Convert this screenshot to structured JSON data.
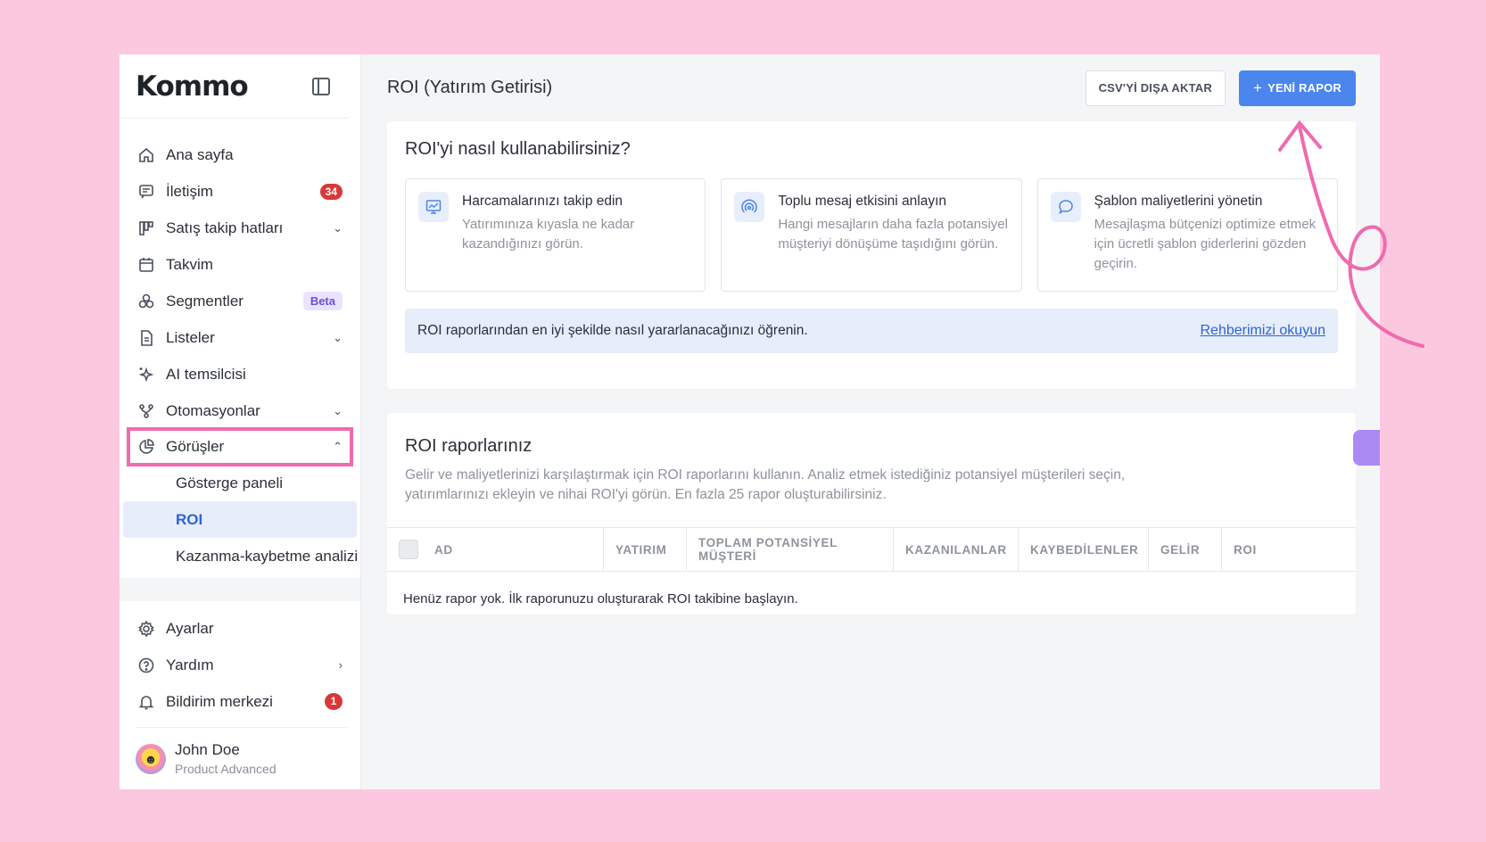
{
  "sidebar": {
    "logo": "Kommo",
    "items": [
      {
        "label": "Ana sayfa",
        "icon": "home-icon"
      },
      {
        "label": "İletişim",
        "icon": "message-icon",
        "badge": "34"
      },
      {
        "label": "Satış takip hatları",
        "icon": "pipeline-icon"
      },
      {
        "label": "Takvim",
        "icon": "calendar-icon"
      },
      {
        "label": "Segmentler",
        "icon": "segments-icon",
        "badge": "Beta"
      },
      {
        "label": "Listeler",
        "icon": "document-icon"
      },
      {
        "label": "AI temsilcisi",
        "icon": "sparkle-icon"
      },
      {
        "label": "Otomasyonlar",
        "icon": "flow-icon"
      },
      {
        "label": "Görüşler",
        "icon": "pie-chart-icon"
      }
    ],
    "subitems": [
      "Gösterge paneli",
      "ROI",
      "Kazanma-kaybetme analizi"
    ],
    "bottom": [
      {
        "label": "Ayarlar",
        "icon": "gear-icon"
      },
      {
        "label": "Yardım",
        "icon": "help-icon"
      },
      {
        "label": "Bildirim merkezi",
        "icon": "bell-icon",
        "badge": "1"
      }
    ],
    "user": {
      "name": "John Doe",
      "plan": "Product Advanced"
    }
  },
  "header": {
    "title": "ROI (Yatırım Getirisi)",
    "export_label": "CSV'Yİ DIŞA AKTAR",
    "new_report_label": "YENİ RAPOR"
  },
  "howto": {
    "title": "ROI'yi nasıl kullanabilirsiniz?",
    "tips": [
      {
        "title": "Harcamalarınızı takip edin",
        "desc": "Yatırımınıza kıyasla ne kadar kazandığınızı görün.",
        "icon": "chart-monitor-icon"
      },
      {
        "title": "Toplu mesaj etkisini anlayın",
        "desc": "Hangi mesajların daha fazla potansiyel müşteriyi dönüşüme taşıdığını görün.",
        "icon": "broadcast-icon"
      },
      {
        "title": "Şablon maliyetlerini yönetin",
        "desc": "Mesajlaşma bütçenizi optimize etmek için ücretli şablon giderlerini gözden geçirin.",
        "icon": "chat-bubble-icon"
      }
    ],
    "info_text": "ROI raporlarından en iyi şekilde nasıl yararlanacağınızı öğrenin.",
    "info_link": "Rehberimizi okuyun"
  },
  "reports": {
    "title": "ROI raporlarınız",
    "desc": "Gelir ve maliyetlerinizi karşılaştırmak için ROI raporlarını kullanın. Analiz etmek istediğiniz potansiyel müşterileri seçin, yatırımlarınızı ekleyin ve nihai ROI'yi görün. En fazla 25 rapor oluşturabilirsiniz.",
    "columns": [
      "AD",
      "YATIRIM",
      "TOPLAM POTANSİYEL MÜŞTERİ",
      "KAZANILANLAR",
      "KAYBEDİLENLER",
      "GELİR",
      "ROI"
    ],
    "empty": "Henüz rapor yok. İlk raporunuzu oluşturarak ROI takibine başlayın."
  },
  "colors": {
    "accent": "#4a86ee",
    "highlight": "#f06aaf",
    "background": "#fcc8e0"
  }
}
